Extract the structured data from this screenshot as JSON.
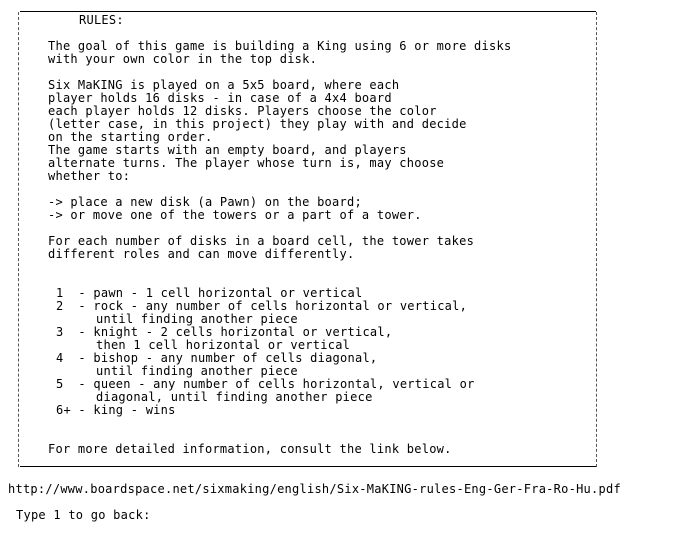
{
  "rules": {
    "title": "RULES:",
    "goal_lines": [
      "The goal of this game is building a King using 6 or more disks",
      "with your own color in the top disk."
    ],
    "setup_lines": [
      "Six MaKING is played on a 5x5 board, where each",
      "player holds 16 disks - in case of a 4x4 board",
      "each player holds 12 disks. Players choose the color",
      "(letter case, in this project) they play with and decide",
      "on the starting order.",
      "The game starts with an empty board, and players",
      "alternate turns. The player whose turn is, may choose",
      "whether to:"
    ],
    "options": [
      "-> place a new disk (a Pawn) on the board;",
      "-> or move one of the towers or a part of a tower."
    ],
    "roles_intro": [
      "For each number of disks in a board cell, the tower takes",
      "different roles and can move differently."
    ],
    "pieces": [
      {
        "line": "1  - pawn - 1 cell horizontal or vertical",
        "cont": []
      },
      {
        "line": "2  - rock - any number of cells horizontal or vertical,",
        "cont": [
          "until finding another piece"
        ]
      },
      {
        "line": "3  - knight - 2 cells horizontal or vertical,",
        "cont": [
          "then 1 cell horizontal or vertical"
        ]
      },
      {
        "line": "4  - bishop - any number of cells diagonal,",
        "cont": [
          "until finding another piece"
        ]
      },
      {
        "line": "5  - queen - any number of cells horizontal, vertical or",
        "cont": [
          "diagonal, until finding another piece"
        ]
      },
      {
        "line": "6+ - king - wins",
        "cont": []
      }
    ],
    "footer": "For more detailed information, consult the link below."
  },
  "link": "http://www.boardspace.net/sixmaking/english/Six-MaKING-rules-Eng-Ger-Fra-Ro-Hu.pdf",
  "prompt": "Type 1 to go back:"
}
